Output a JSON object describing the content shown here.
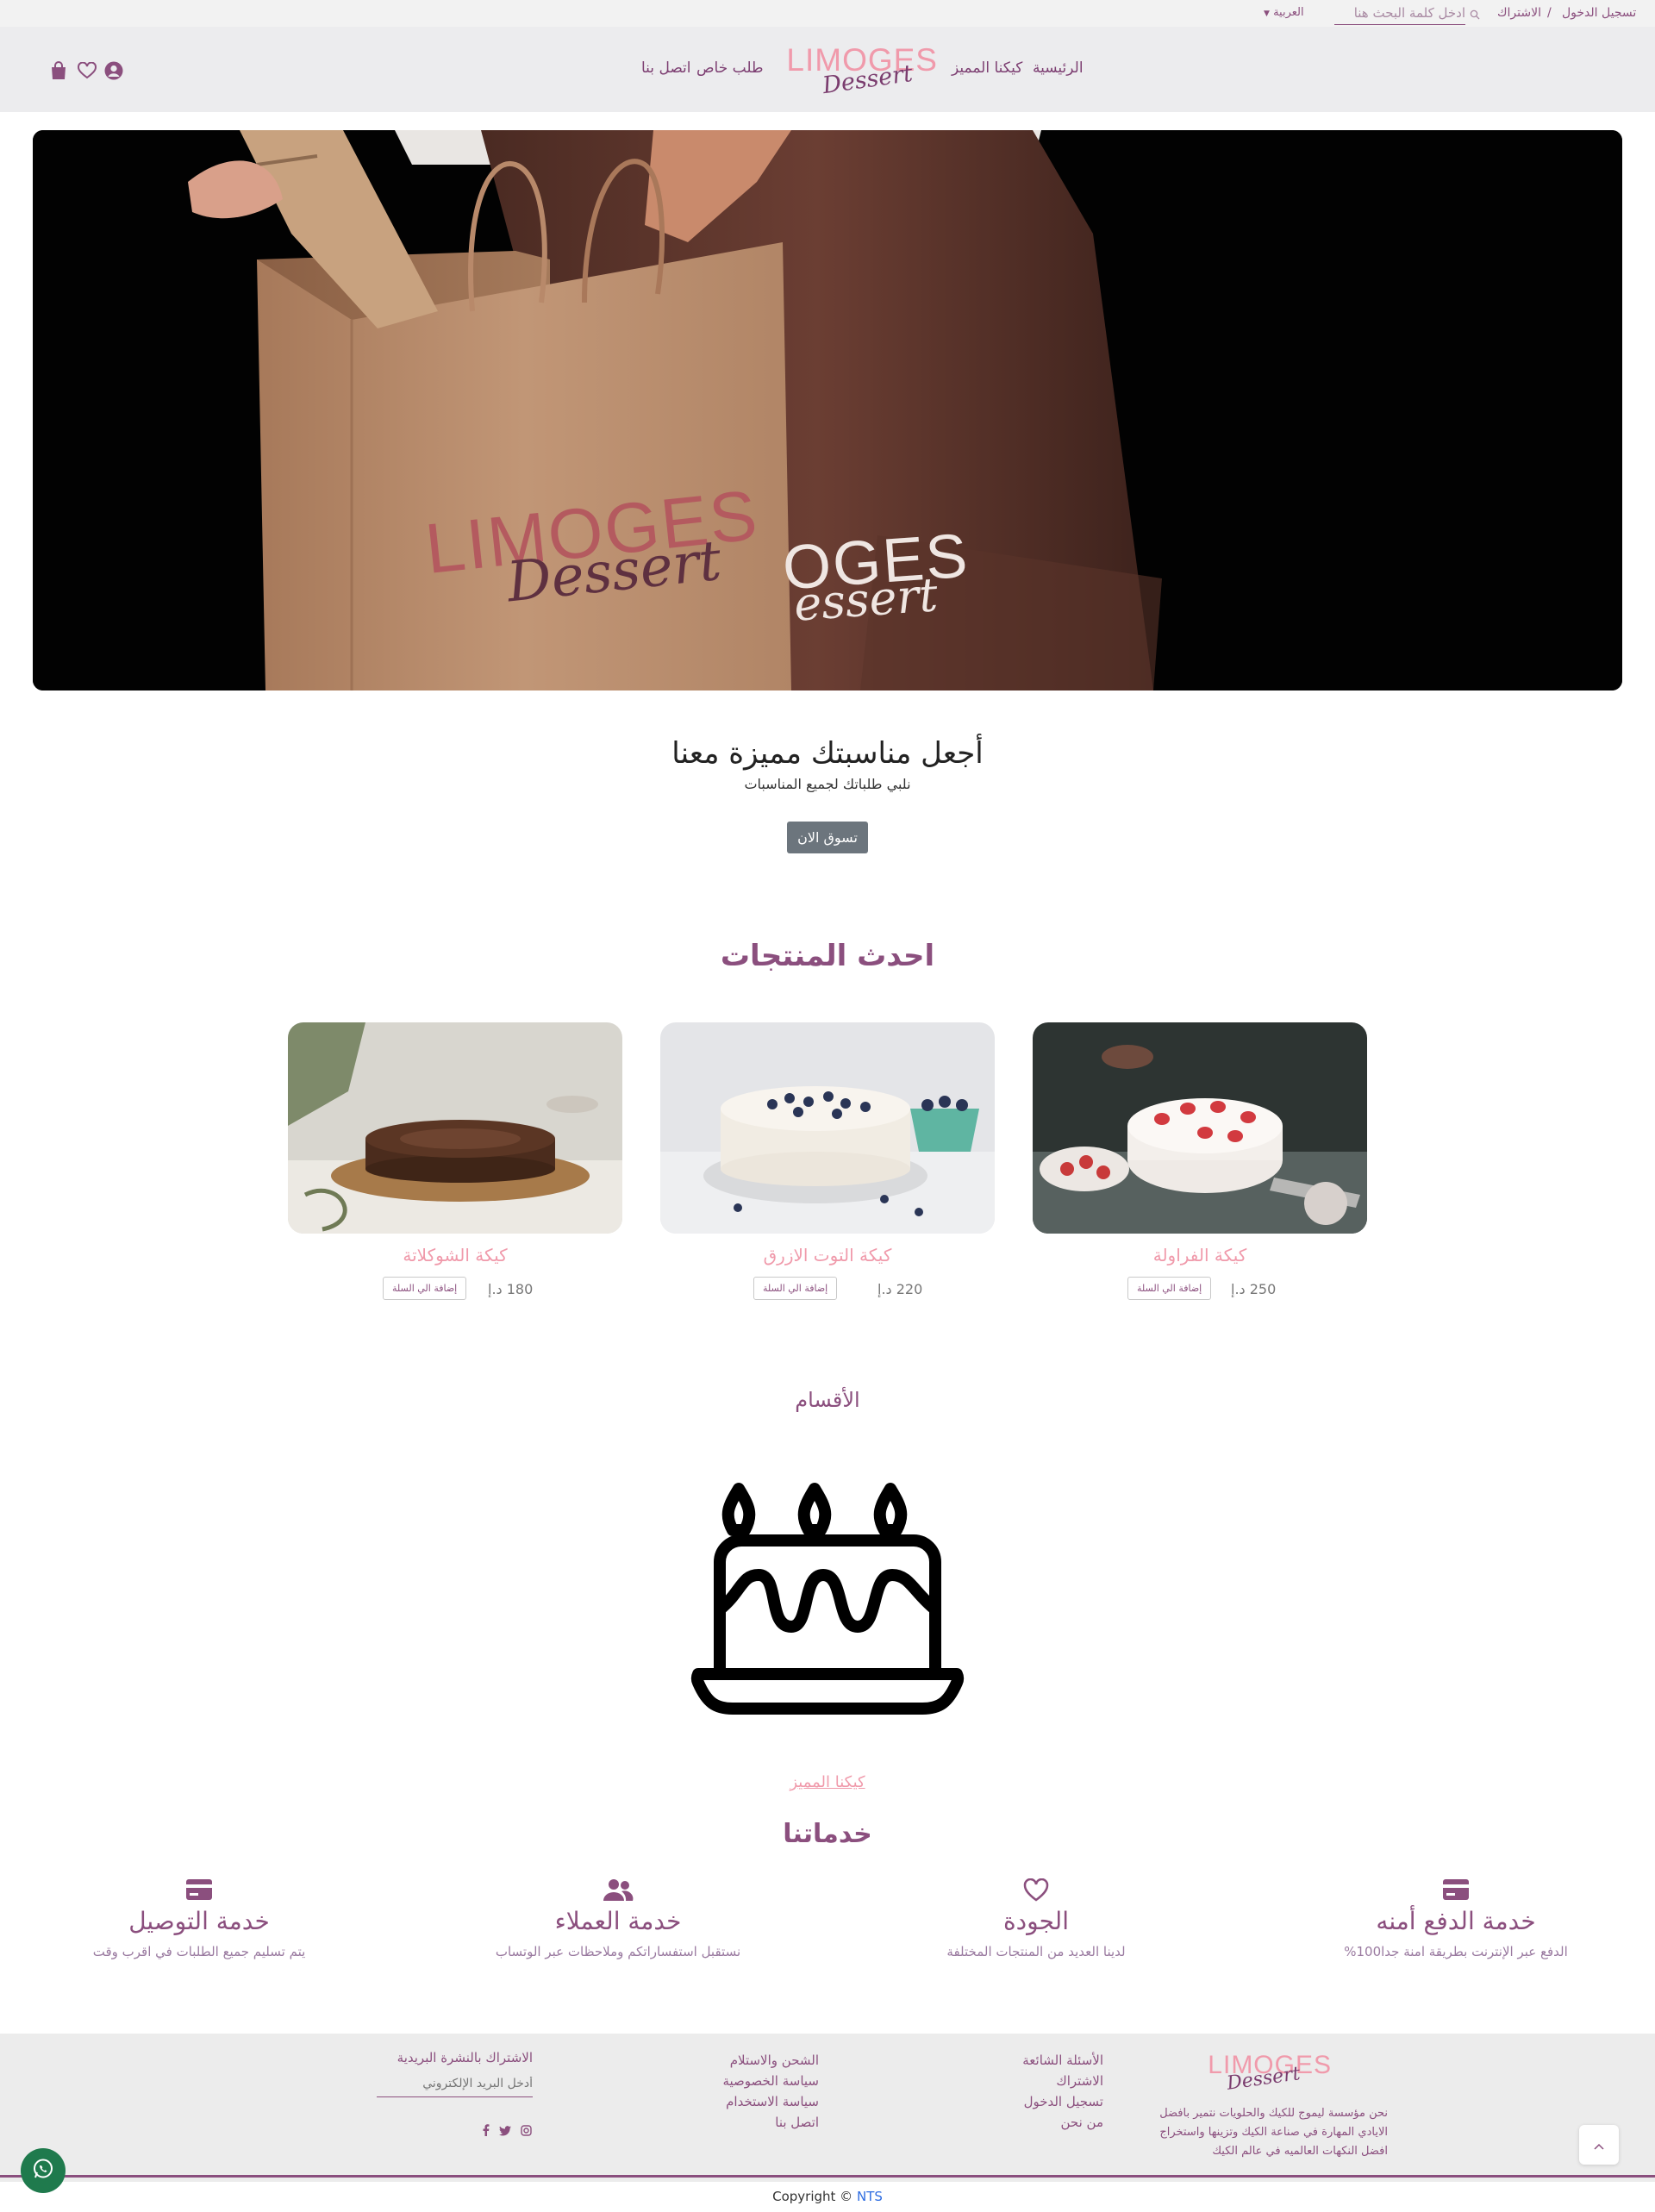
{
  "topbar": {
    "login": "تسجيل الدخول",
    "separator": "/",
    "signup": "الاشتراك",
    "search_placeholder": "ادخل كلمة البحث هنا",
    "language": "العربية"
  },
  "header": {
    "nav": [
      "الرئيسية",
      "كيكنا المميز",
      "طلب خاص",
      "اتصل بنا"
    ],
    "logo_main": "LIMOGES",
    "logo_sub": "Dessert"
  },
  "hero": {
    "bag_logo_main": "LIMOGES",
    "bag_logo_sub": "Dessert",
    "apron_logo_main": "OGES",
    "apron_logo_sub": "essert",
    "heading": "أجعل مناسبتك مميزة معنا",
    "subheading": "نلبي طلباتك لجميع المناسبات",
    "cta": "تسوق الان"
  },
  "latest": {
    "title": "احدث المنتجات",
    "add_to_cart": "إضافة الي السلة",
    "products": [
      {
        "name": "كيكة الفراولة",
        "price": "250 د.إ"
      },
      {
        "name": "كيكة التوت الازرق",
        "price": "220 د.إ"
      },
      {
        "name": "كيكة الشوكلاتة",
        "price": "180 د.إ"
      }
    ]
  },
  "categories": {
    "title": "الأقسام",
    "item": "كيكنا المميز"
  },
  "services": {
    "title": "خدماتنا",
    "items": [
      {
        "title": "خدمة الدفع أمنه",
        "desc": "الدفع عبر الإنترنت بطريقة امنة جدا100%",
        "icon": "credit-card-icon"
      },
      {
        "title": "الجودة",
        "desc": "لدينا العديد من المنتجات المختلفة",
        "icon": "heart-icon"
      },
      {
        "title": "خدمة العملاء",
        "desc": "نستقبل استفساراتكم وملاحظات عبر الوتساب",
        "icon": "users-icon"
      },
      {
        "title": "خدمة التوصيل",
        "desc": "يتم تسليم جميع الطلبات في اقرب وقت",
        "icon": "credit-card-icon"
      }
    ]
  },
  "footer": {
    "logo_main": "LIMOGES",
    "logo_sub": "Dessert",
    "about_lines": [
      "نحن مؤسسة ليموج للكيك والحلويات نتمير بافضل",
      "الايادي المهارة في صناعة الكيك وتزينها واستخراج",
      "افضل النكهات العالميه في عالم الكيك"
    ],
    "col1": [
      "الأسئلة الشائعة",
      "الاشتراك",
      "تسجيل الدخول",
      "من نحن"
    ],
    "col2": [
      "الشحن والاستلام",
      "سياسة الخصوصية",
      "سياسة الاستخدام",
      "اتصل بنا"
    ],
    "newsletter_title": "الاشتراك بالنشرة البريدية",
    "email_placeholder": "أدخل البريد الإلكتروني",
    "copyright": "Copyright ©",
    "copyright_link": "NTS"
  },
  "colors": {
    "brand_purple": "#8b4f7e",
    "brand_pink": "#f09aab",
    "whatsapp": "#1f7a4d"
  }
}
